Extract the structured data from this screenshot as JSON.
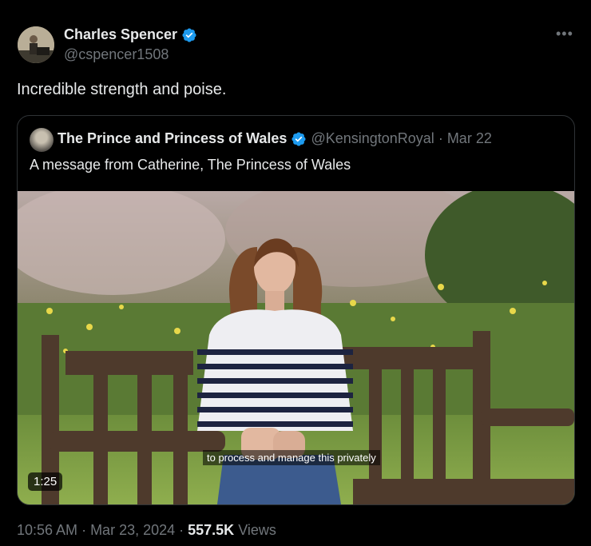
{
  "tweet": {
    "author_name": "Charles Spencer",
    "author_handle": "@cspencer1508",
    "more_icon": "•••",
    "text": "Incredible strength and poise.",
    "time": "10:56 AM",
    "sep": "·",
    "date": "Mar 23, 2024",
    "views_count": "557.5K",
    "views_label": "Views"
  },
  "quote": {
    "author_name": "The Prince and Princess of Wales",
    "author_handle": "@KensingtonRoyal",
    "sep": "·",
    "date": "Mar 22",
    "text": "A message from Catherine, The Princess of Wales",
    "video": {
      "duration": "1:25",
      "caption": "to process and manage this privately"
    }
  },
  "colors": {
    "background": "#000000",
    "text_primary": "#e7e9ea",
    "text_secondary": "#71767b",
    "verified_badge": "#1d9bf0",
    "border": "#2f3336"
  },
  "icons": {
    "verified": "verified-badge-icon",
    "more": "more-options-icon"
  }
}
